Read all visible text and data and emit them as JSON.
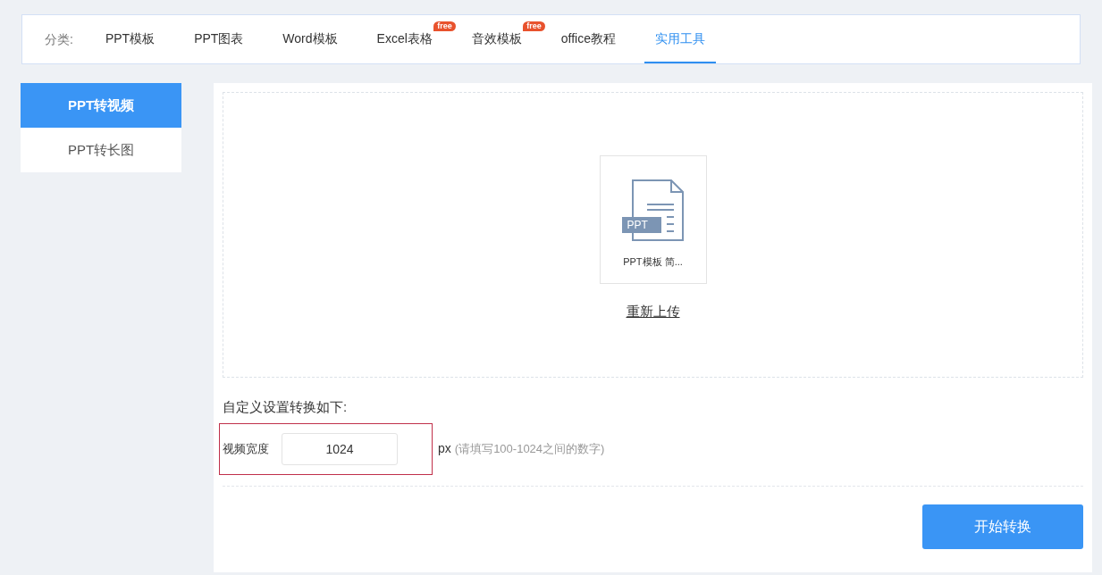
{
  "nav": {
    "label": "分类:",
    "tabs": [
      {
        "label": "PPT模板",
        "selected": false
      },
      {
        "label": "PPT图表",
        "selected": false
      },
      {
        "label": "Word模板",
        "selected": false
      },
      {
        "label": "Excel表格",
        "selected": false,
        "badge": "free"
      },
      {
        "label": "音效模板",
        "selected": false,
        "badge": "free"
      },
      {
        "label": "office教程",
        "selected": false
      },
      {
        "label": "实用工具",
        "selected": true
      }
    ]
  },
  "sidebar": {
    "items": [
      {
        "label": "PPT转视频",
        "selected": true
      },
      {
        "label": "PPT转长图",
        "selected": false
      }
    ]
  },
  "upload": {
    "file_badge": "PPT",
    "file_name": "PPT模板 简...",
    "reupload_link": "重新上传"
  },
  "settings": {
    "heading": "自定义设置转换如下:",
    "width_label": "视频宽度",
    "width_value": "1024",
    "unit": "px",
    "hint": "(请填写100-1024之间的数字)"
  },
  "start_button": "开始转换"
}
